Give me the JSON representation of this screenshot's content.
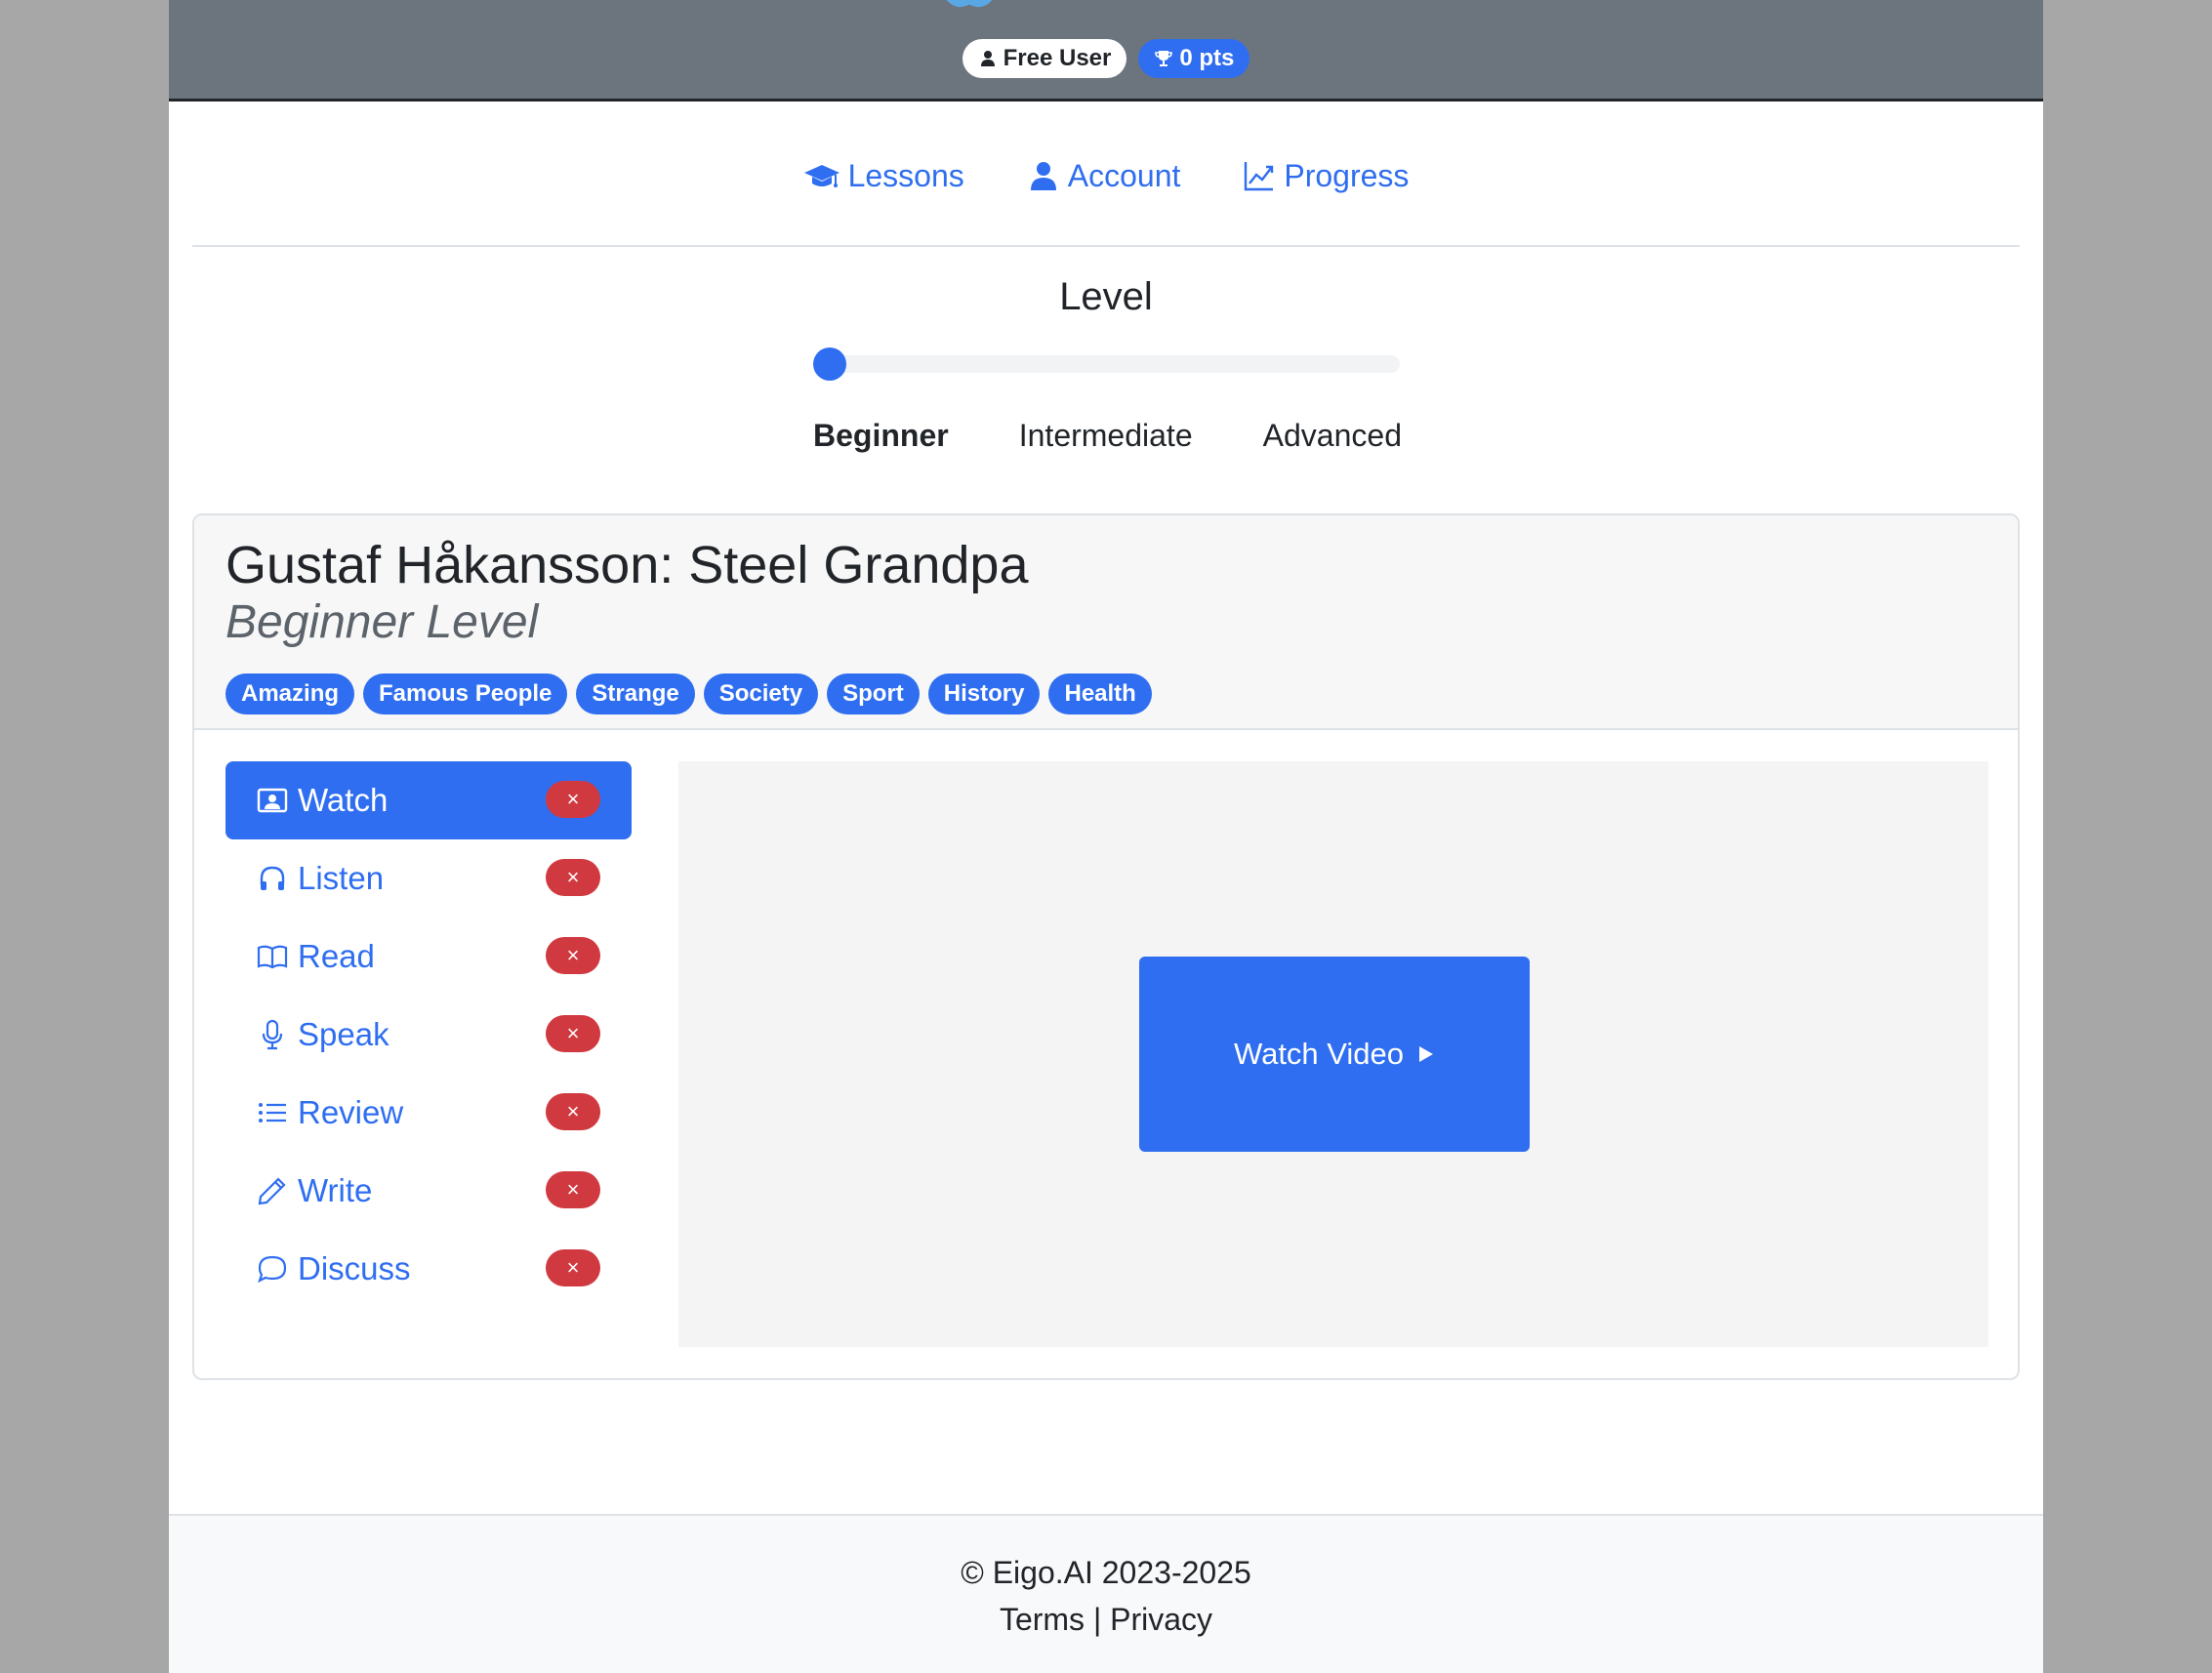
{
  "header": {
    "user_badge": "Free User",
    "points_badge": "0 pts"
  },
  "nav": {
    "lessons": "Lessons",
    "account": "Account",
    "progress": "Progress"
  },
  "level": {
    "title": "Level",
    "options": [
      "Beginner",
      "Intermediate",
      "Advanced"
    ],
    "selected": "Beginner"
  },
  "lesson": {
    "title": "Gustaf Håkansson: Steel Grandpa",
    "level_label": "Beginner Level",
    "tags": [
      "Amazing",
      "Famous People",
      "Strange",
      "Society",
      "Sport",
      "History",
      "Health"
    ]
  },
  "menu": {
    "items": [
      {
        "label": "Watch",
        "icon": "video-icon",
        "status": "×"
      },
      {
        "label": "Listen",
        "icon": "headphones-icon",
        "status": "×"
      },
      {
        "label": "Read",
        "icon": "book-icon",
        "status": "×"
      },
      {
        "label": "Speak",
        "icon": "microphone-icon",
        "status": "×"
      },
      {
        "label": "Review",
        "icon": "list-icon",
        "status": "×"
      },
      {
        "label": "Write",
        "icon": "pencil-icon",
        "status": "×"
      },
      {
        "label": "Discuss",
        "icon": "chat-icon",
        "status": "×"
      }
    ],
    "active": "Watch"
  },
  "media": {
    "button_label": "Watch Video"
  },
  "footer": {
    "copyright": "© Eigo.AI 2023-2025",
    "terms": "Terms",
    "separator": "|",
    "privacy": "Privacy"
  },
  "colors": {
    "primary": "#2f6ef0",
    "danger": "#d0393f",
    "header_bg": "#6c757d"
  }
}
